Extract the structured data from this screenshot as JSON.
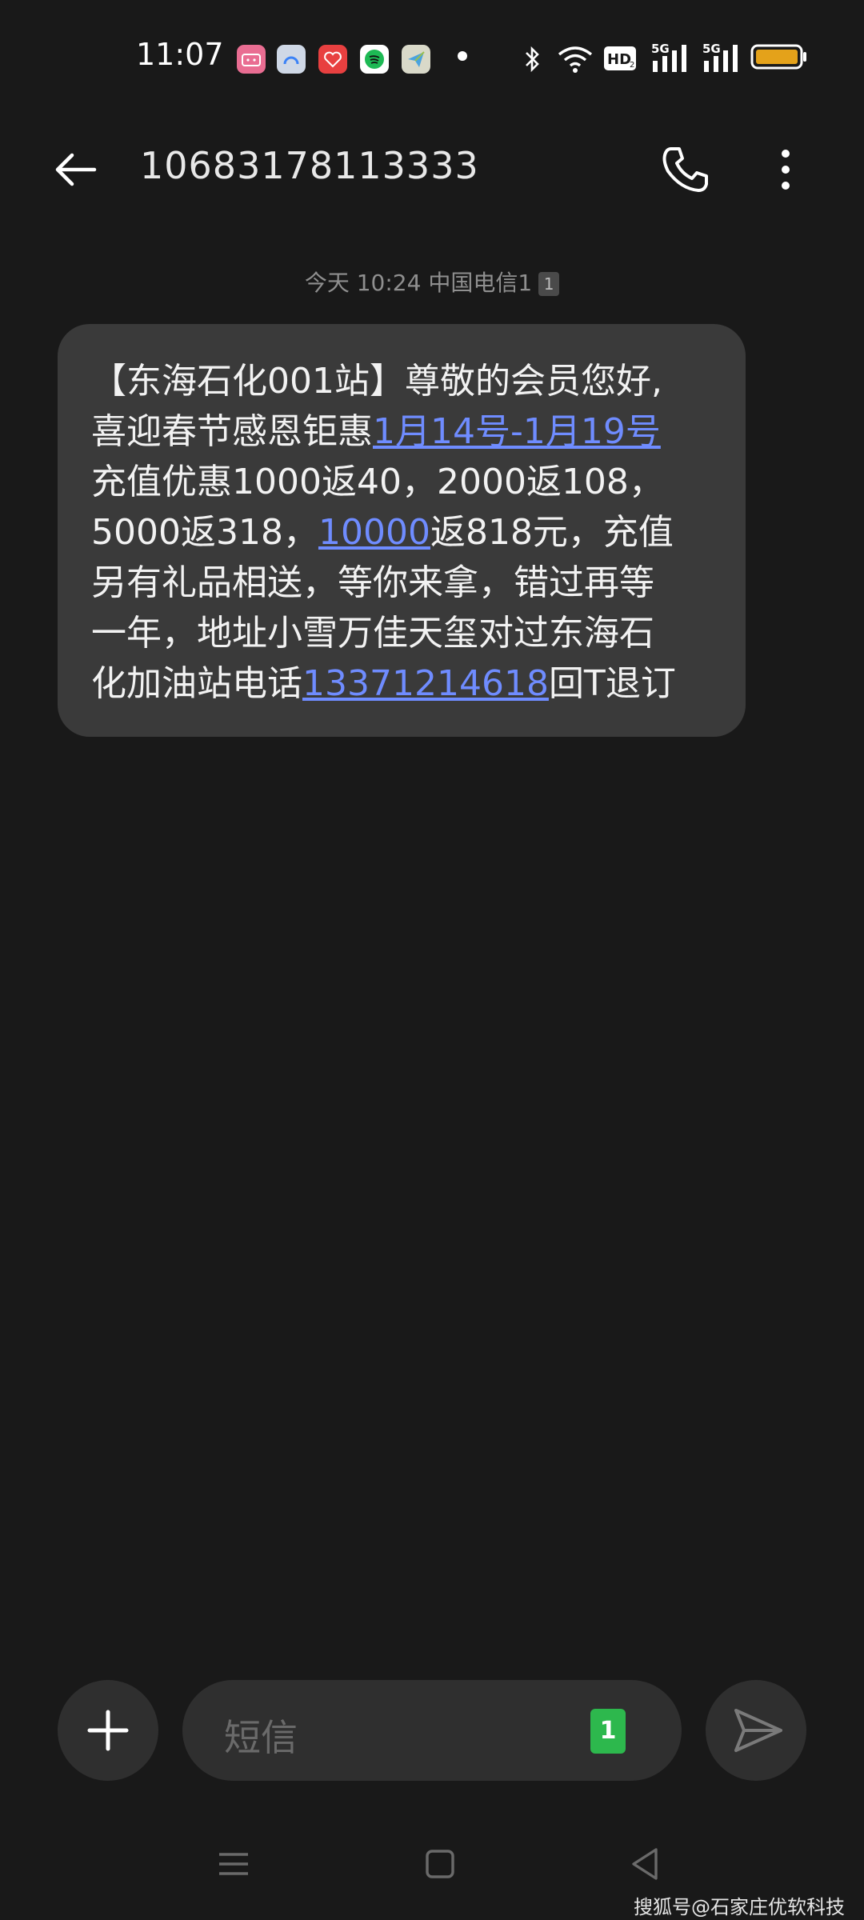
{
  "status_bar": {
    "time": "11:07",
    "app_icons": [
      "bilibili-icon",
      "generic-app-icon",
      "heart-app-icon",
      "spotify-icon",
      "paper-plane-app-icon"
    ],
    "colors": {
      "bilibili": "#e96d92",
      "generic": "#7aa9ff",
      "heart": "#e84040",
      "spotify": "#1db954",
      "plane": "#9cbf4e",
      "battery": "#e4a21a"
    }
  },
  "header": {
    "title": "10683178113333"
  },
  "timestamp": {
    "text": "今天 10:24  中国电信1",
    "sim": "1"
  },
  "message": {
    "lines": [
      [
        {
          "t": "【东海石化001站】尊敬的会员您好,"
        }
      ],
      [
        {
          "t": "喜迎春节感恩钜惠"
        },
        {
          "t": "1月14号-1月19号",
          "link": true
        }
      ],
      [
        {
          "t": "充值优惠1000返40，2000返108，"
        }
      ],
      [
        {
          "t": "5000返318，"
        },
        {
          "t": "10000",
          "link": true
        },
        {
          "t": "返818元，充值"
        }
      ],
      [
        {
          "t": "另有礼品相送，等你来拿，错过再等"
        }
      ],
      [
        {
          "t": "一年，地址小雪万佳天玺对过东海石"
        }
      ],
      [
        {
          "t": "化加油站电话"
        },
        {
          "t": "13371214618",
          "link": true
        },
        {
          "t": "回T退订"
        }
      ]
    ],
    "link_color": "#6f8cff"
  },
  "composer": {
    "placeholder": "短信",
    "sim_badge": "1"
  },
  "watermark": "搜狐号@石家庄优软科技"
}
